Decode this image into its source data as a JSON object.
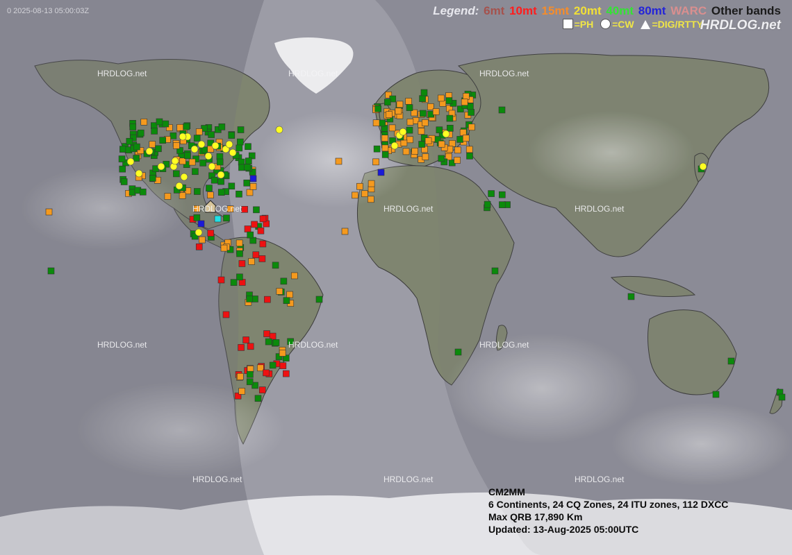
{
  "timestamp": "0 2025-08-13 05:00:03Z",
  "legend": {
    "title": "Legend:",
    "bands": [
      {
        "label": "6mt",
        "color": "#a5524d"
      },
      {
        "label": "10mt",
        "color": "#ff1d1d"
      },
      {
        "label": "15mt",
        "color": "#f58c2b"
      },
      {
        "label": "20mt",
        "color": "#f2e036"
      },
      {
        "label": "40mt",
        "color": "#35e235"
      },
      {
        "label": "80mt",
        "color": "#2424d8"
      },
      {
        "label": "WARC",
        "color": "#d98f8f"
      },
      {
        "label": "Other bands",
        "color": "#1b1b1b"
      }
    ],
    "modes": {
      "phone": "=PH",
      "cw": "=CW",
      "digital": "=DIG/RTTY"
    }
  },
  "brand": "HRDLOG.net",
  "watermark": "HRDLOG.net",
  "info": {
    "callsign": "CM2MM",
    "stats": "6 Continents, 24 CQ Zones, 24 ITU zones, 112 DXCC",
    "max_qrb": "Max QRB 17,890 Km",
    "updated": "Updated: 13-Aug-2025 05:00UTC"
  },
  "home_icon": "house-icon",
  "spot_colors": {
    "green": "#0b8a0b",
    "orange": "#f59a1e",
    "red": "#ee1111",
    "blue": "#1a1ad8",
    "cyan": "#22e0e6",
    "yellow": "#ffff22"
  }
}
